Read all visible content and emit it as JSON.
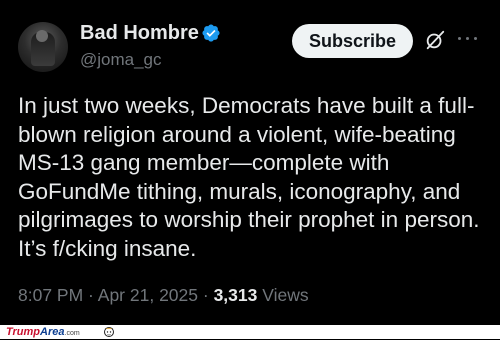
{
  "author": {
    "display_name": "Bad Hombre",
    "handle": "@joma_gc",
    "verified": true,
    "avatar_icon": "avatar-photo"
  },
  "actions": {
    "subscribe_label": "Subscribe",
    "grok_icon": "grok-slash-circle-icon",
    "more_icon": "more-dots-icon"
  },
  "tweet": {
    "text": "In just two weeks, Democrats have built a full-blown religion around a violent, wife-beating MS-13 gang member—complete with GoFundMe tithing, murals, iconography, and pilgrimages to worship their prophet in person. It’s f/cking insane."
  },
  "meta": {
    "time": "8:07 PM",
    "separator": " · ",
    "date": "Apr 21, 2025",
    "views_count": "3,313",
    "views_label": " Views"
  },
  "watermark": {
    "brand_part1": "Trump",
    "brand_part2": "Area",
    "brand_suffix": ".com"
  },
  "colors": {
    "background": "#000000",
    "text_primary": "#e7e9ea",
    "text_secondary": "#71767b",
    "verified_blue": "#1d9bf0",
    "button_bg": "#eff3f4"
  }
}
